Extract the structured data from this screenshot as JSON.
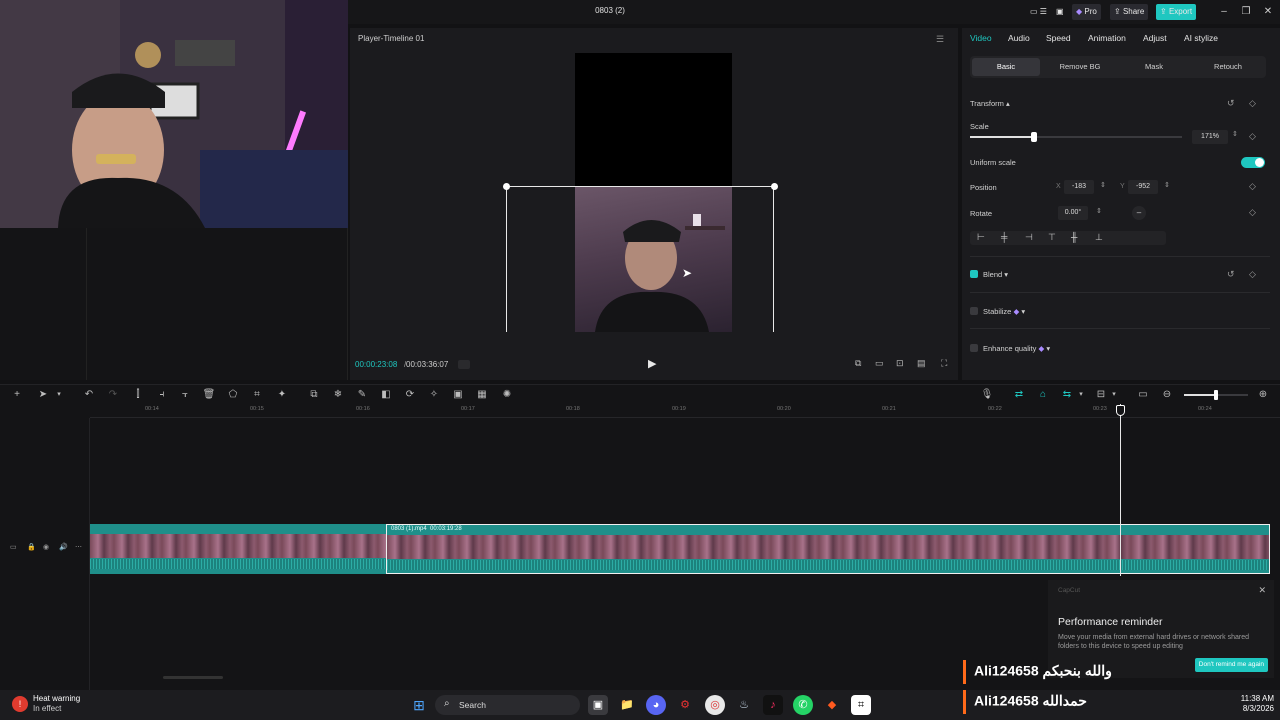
{
  "window": {
    "title": "0803 (2)",
    "pro_label": "Pro",
    "share_label": "Share",
    "export_label": "Export"
  },
  "player": {
    "title": "Player-Timeline 01",
    "current_time": "00:00:23:08",
    "total_time": "00:03:36:07"
  },
  "right_panel": {
    "tabs": [
      "Video",
      "Audio",
      "Speed",
      "Animation",
      "Adjust",
      "AI stylize"
    ],
    "active_tab": "Video",
    "subtabs": [
      "Basic",
      "Remove BG",
      "Mask",
      "Retouch"
    ],
    "active_subtab": "Basic",
    "transform_label": "Transform",
    "scale_label": "Scale",
    "scale_value": "171%",
    "scale_fraction": 0.3,
    "uniform_scale_label": "Uniform scale",
    "uniform_scale_on": true,
    "position_label": "Position",
    "x_label": "X",
    "x_value": "-183",
    "y_label": "Y",
    "y_value": "-952",
    "rotate_label": "Rotate",
    "rotate_value": "0.00°",
    "rotate_dash": "–",
    "blend_label": "Blend",
    "stabilize_label": "Stabilize",
    "enhance_label": "Enhance quality",
    "accent": "#1fc7c0"
  },
  "timeline": {
    "ruler_ticks": [
      "00:14",
      "00:15",
      "00:16",
      "00:17",
      "00:18",
      "00:19",
      "00:20",
      "00:21",
      "00:22",
      "00:23",
      "00:24"
    ],
    "clip_name": "0803 (1).mp4",
    "clip_duration": "00:03:19:28"
  },
  "toast": {
    "brand": "CapCut",
    "title": "Performance reminder",
    "message": "Move your media from external hard drives or network shared folders to this device to speed up editing",
    "button": "Don't remind me again"
  },
  "overlays": {
    "line1": "Ali124658 والله بنحبكم",
    "line2": "Ali124658 حمدالله"
  },
  "taskbar": {
    "heat_title": "Heat warning",
    "heat_sub": "In effect",
    "search": "Search",
    "time": "11:38 AM",
    "date": "8/3/2026"
  }
}
